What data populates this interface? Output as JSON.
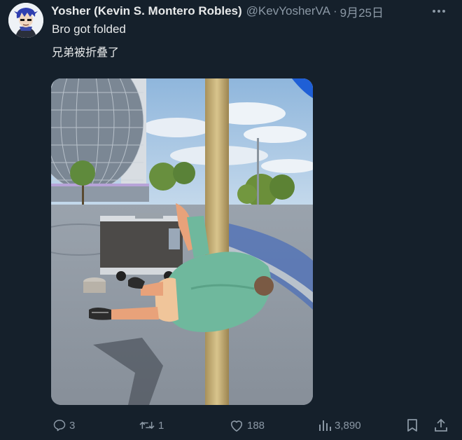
{
  "tweet": {
    "display_name": "Yosher (Kevin S. Montero Robles)",
    "handle": "@KevYosherVA",
    "separator": "·",
    "date": "9月25日",
    "text_line1": "Bro got folded",
    "text_line2": "兄弟被折叠了"
  },
  "actions": {
    "replies": "3",
    "retweets": "1",
    "likes": "188",
    "views": "3,890"
  },
  "icons": {
    "avatar": "avatar-icon",
    "more": "more-dots-icon",
    "reply": "reply-icon",
    "retweet": "retweet-icon",
    "like": "heart-icon",
    "views": "views-bar-chart-icon",
    "bookmark": "bookmark-icon",
    "share": "share-icon"
  },
  "colors": {
    "background": "#15202b",
    "text": "#e7e9ea",
    "secondary": "#8b98a5"
  }
}
